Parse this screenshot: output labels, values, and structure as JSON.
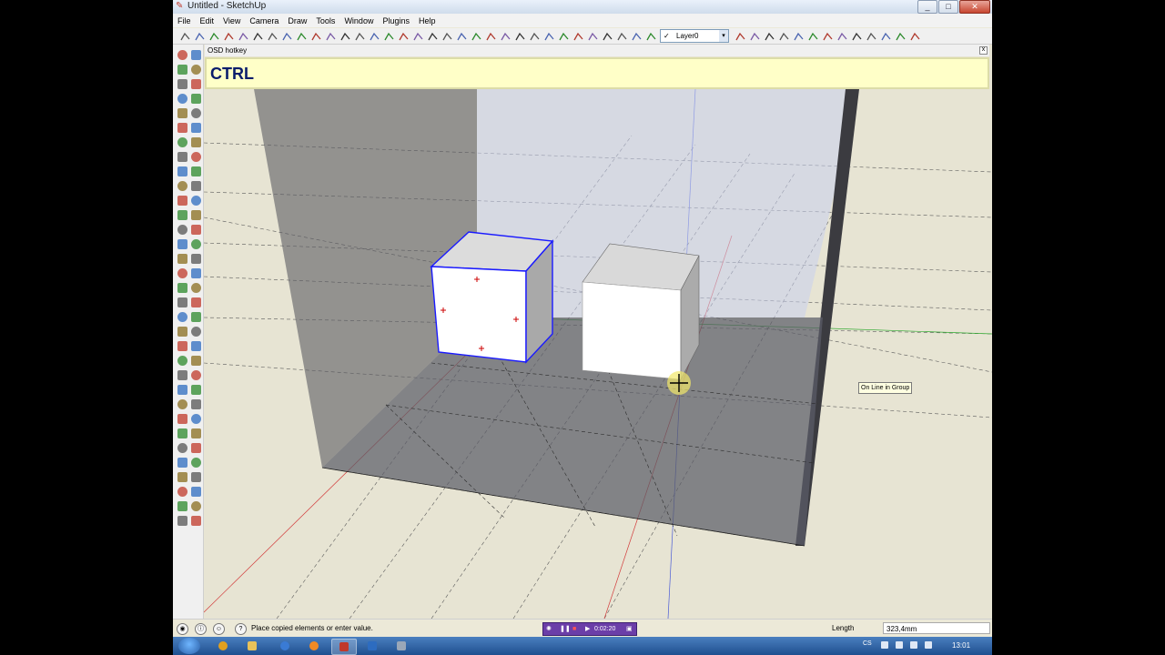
{
  "window": {
    "title": "Untitled - SketchUp",
    "min": "_",
    "max": "□",
    "close": "✕"
  },
  "menu": [
    "File",
    "Edit",
    "View",
    "Camera",
    "Draw",
    "Tools",
    "Window",
    "Plugins",
    "Help"
  ],
  "toolbar": {
    "layer_check": "✓",
    "layer_name": "Layer0",
    "layer_arrow": "▾"
  },
  "osd": {
    "header": "OSD hotkey",
    "key": "CTRL",
    "close": "x"
  },
  "inference_tooltip": "On Line in Group",
  "status": {
    "message": "Place copied elements or enter value.",
    "help_icon": "?",
    "icons": [
      "geo-icon",
      "credits-icon",
      "user-icon"
    ],
    "recorder_time": "0:02:20",
    "vcb_label": "Length",
    "vcb_value": "323,4mm"
  },
  "taskbar": {
    "language": "CS",
    "clock": "13:01"
  },
  "colors": {
    "osd_bg": "#ffffc8",
    "osd_text": "#0a1c6b",
    "selection": "#1a1aff",
    "recorder": "#6b3ea8"
  }
}
